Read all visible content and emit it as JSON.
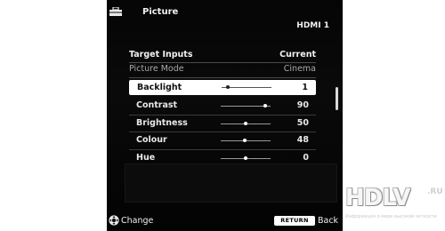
{
  "menu": {
    "title": "Picture",
    "input_name": "HDMI 1"
  },
  "target": {
    "label": "Target Inputs",
    "value": "Current"
  },
  "picture_mode": {
    "label": "Picture Mode",
    "value": "Cinema"
  },
  "settings": [
    {
      "label": "Backlight",
      "value": "1",
      "level": 0.12,
      "selected": true
    },
    {
      "label": "Contrast",
      "value": "90",
      "level": 0.9,
      "selected": false
    },
    {
      "label": "Brightness",
      "value": "50",
      "level": 0.5,
      "selected": false
    },
    {
      "label": "Colour",
      "value": "48",
      "level": 0.48,
      "selected": false
    },
    {
      "label": "Hue",
      "value": "0",
      "level": 0.5,
      "selected": false
    }
  ],
  "footer": {
    "change_label": "Change",
    "return_label": "RETURN",
    "back_label": "Back"
  },
  "watermark": {
    "logo": "HDLV",
    "suffix": ".RU",
    "tagline": "Информация о мире высокой четкости"
  },
  "icons": {
    "header": "toolbox-icon",
    "change": "dpad-icon"
  }
}
